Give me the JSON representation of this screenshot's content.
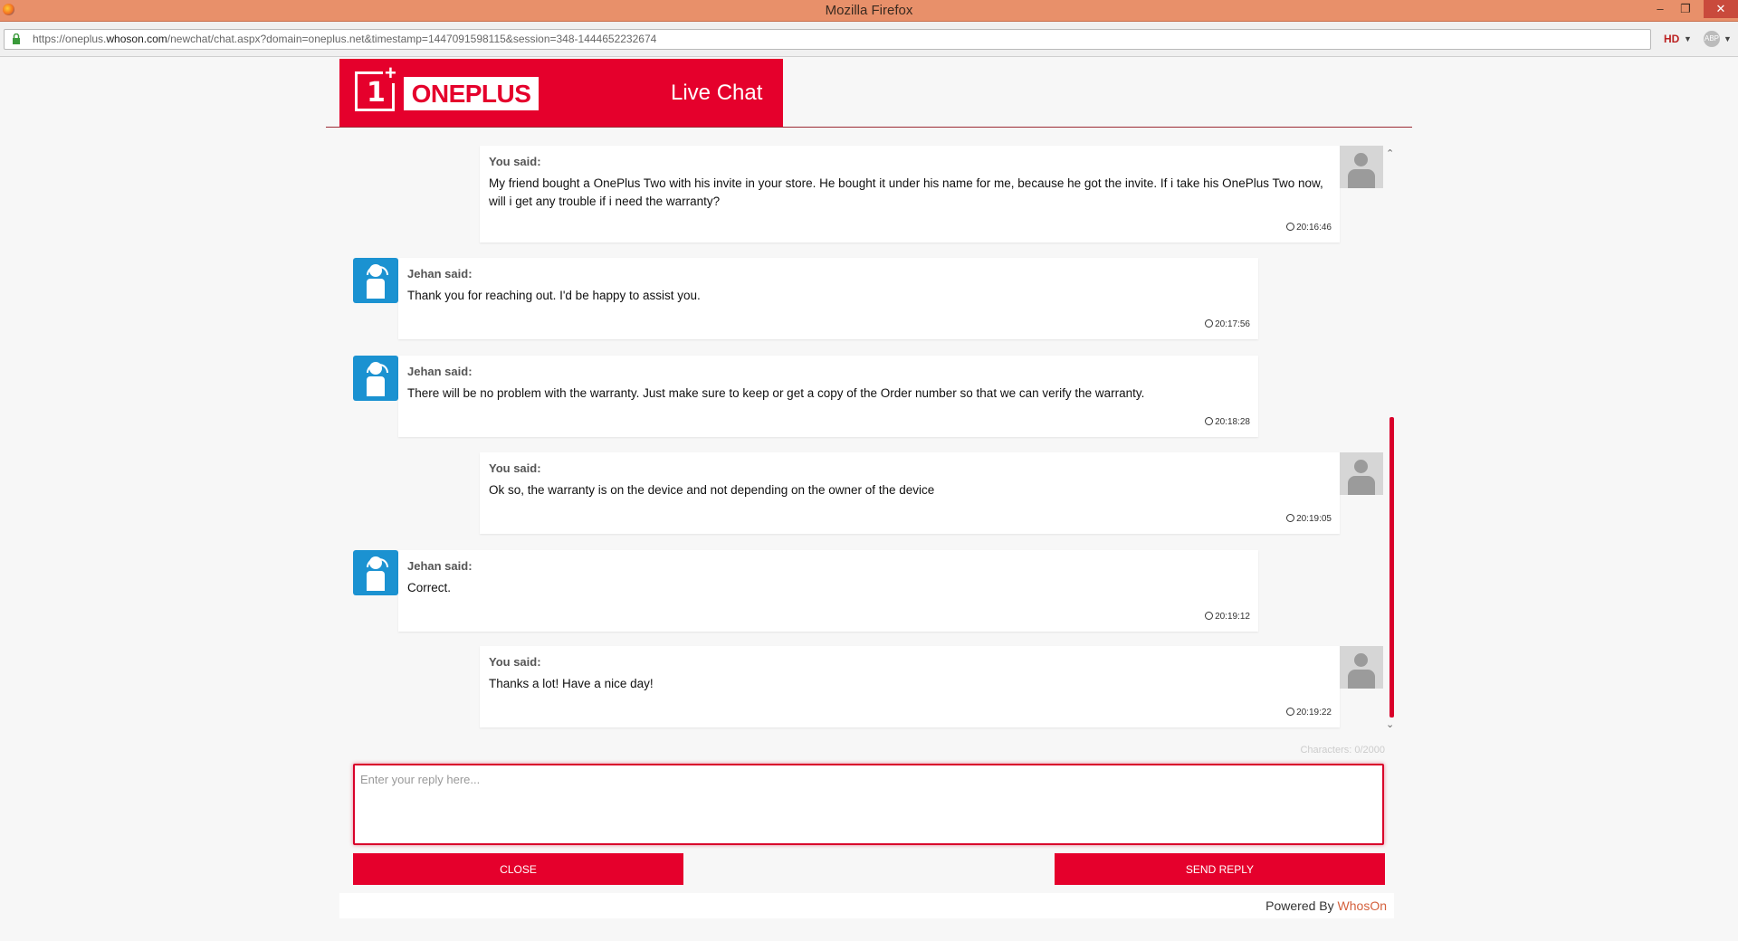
{
  "window": {
    "title": "Mozilla Firefox"
  },
  "browser": {
    "url_prefix": "https://oneplus.",
    "url_host": "whoson.com",
    "url_rest": "/newchat/chat.aspx?domain=oneplus.net&timestamp=1447091598115&session=348-1444652232674",
    "hd_label": "HD",
    "abp_label": "ABP"
  },
  "header": {
    "brand_word": "ONEPLUS",
    "logo_digit": "1",
    "logo_plus": "+",
    "title": "Live Chat"
  },
  "messages": [
    {
      "sender": "user",
      "who": "You said:",
      "text": "My friend bought a OnePlus Two with his invite in your store. He bought it under his name for me, because he got the invite. If i take his OnePlus Two now, will i get any trouble if i need the warranty?",
      "time": "20:16:46"
    },
    {
      "sender": "agent",
      "who": "Jehan said:",
      "text": "Thank you for reaching out. I'd be happy to assist you.",
      "time": "20:17:56"
    },
    {
      "sender": "agent",
      "who": "Jehan said:",
      "text": "There will be no problem with the warranty. Just make sure to keep or get a copy of the Order number so that we can verify the warranty.",
      "time": "20:18:28"
    },
    {
      "sender": "user",
      "who": "You said:",
      "text": "Ok so, the warranty is on the device and not depending on the owner of the device",
      "time": "20:19:05"
    },
    {
      "sender": "agent",
      "who": "Jehan said:",
      "text": "Correct.",
      "time": "20:19:12"
    },
    {
      "sender": "user",
      "who": "You said:",
      "text": "Thanks a lot! Have a nice day!",
      "time": "20:19:22"
    }
  ],
  "composer": {
    "char_count": "Characters: 0/2000",
    "placeholder": "Enter your reply here...",
    "value": "",
    "close_label": "CLOSE",
    "send_label": "SEND REPLY"
  },
  "footer": {
    "powered_by": "Powered By",
    "brand": "WhosOn"
  },
  "colors": {
    "brand_red": "#e5002c",
    "agent_blue": "#1b92d1",
    "titlebar": "#e8906a"
  }
}
